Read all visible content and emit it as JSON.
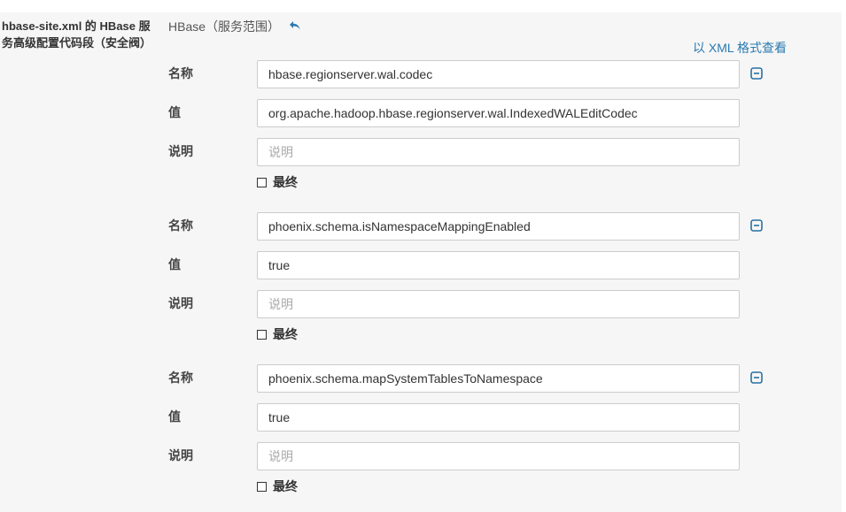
{
  "property": {
    "label": "hbase-site.xml 的 HBase 服务高级配置代码段（安全阀）",
    "scope": "HBase（服务范围）",
    "revert_icon": "undo-arrow-icon",
    "view_xml": "以 XML 格式查看"
  },
  "labels": {
    "name": "名称",
    "value": "值",
    "description": "说明",
    "final": "最终"
  },
  "entries": [
    {
      "name": "hbase.regionserver.wal.codec",
      "value": "org.apache.hadoop.hbase.regionserver.wal.IndexedWALEditCodec",
      "description_placeholder": "说明",
      "final_checked": false
    },
    {
      "name": "phoenix.schema.isNamespaceMappingEnabled",
      "value": "true",
      "description_placeholder": "说明",
      "final_checked": false
    },
    {
      "name": "phoenix.schema.mapSystemTablesToNamespace",
      "value": "true",
      "description_placeholder": "说明",
      "final_checked": false
    }
  ],
  "colors": {
    "accent": "#2a7ab0",
    "panel_bg": "#f6f6f6"
  }
}
